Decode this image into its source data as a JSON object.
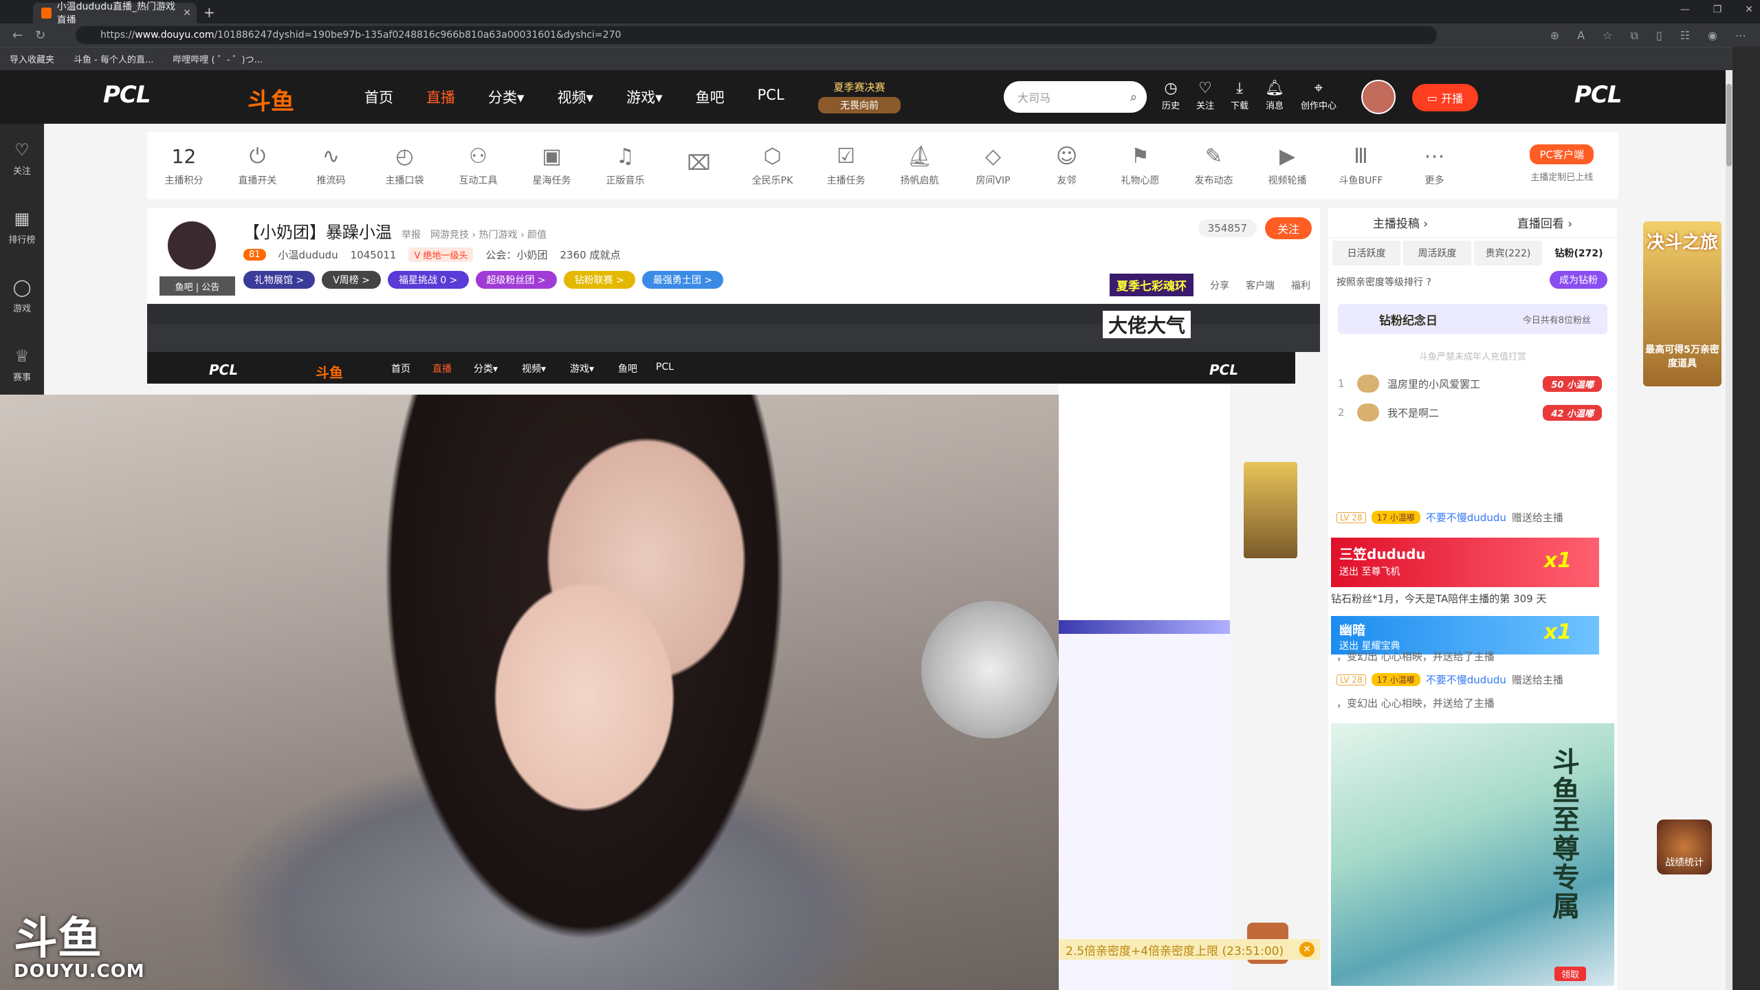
{
  "browser": {
    "tab_title": "小温dududu直播_热门游戏直播",
    "url_prefix": "https://",
    "url_host": "www.douyu.com",
    "url_path": "/101886247dyshid=190be97b-135af0248816c966b810a63a00031601&dyshci=270",
    "bookmarks": [
      "导入收藏夹",
      "斗鱼 - 每个人的直...",
      "哔哩哔哩 ( ゜- ゜)つ..."
    ]
  },
  "topnav": {
    "logo_left": "PCL",
    "logo_right": "PCL",
    "brand": "斗鱼",
    "items": [
      "首页",
      "直播",
      "分类▾",
      "视频▾",
      "游戏▾",
      "鱼吧",
      "PCL"
    ],
    "summer_line1": "夏季赛决赛",
    "summer_line2": "无畏向前",
    "search_placeholder": "大司马",
    "tools": [
      "历史",
      "关注",
      "下载",
      "消息",
      "创作中心"
    ],
    "kaibo": "开播"
  },
  "leftbar": [
    "关注",
    "排行榜",
    "游戏",
    "赛事"
  ],
  "toolbar": {
    "score_num": "12",
    "items": [
      "主播积分",
      "直播开关",
      "推流码",
      "主播口袋",
      "互动工具",
      "星海任务",
      "正版音乐",
      "",
      "全民乐PK",
      "主播任务",
      "扬帆启航",
      "房间VIP",
      "友邻",
      "礼物心愿",
      "发布动态",
      "视频轮播",
      "斗鱼BUFF",
      "更多"
    ],
    "pc_client": "PC客户端",
    "pc_status": "主播定制已上线"
  },
  "room": {
    "title": "【小奶团】暴躁小温",
    "report": "举报",
    "category": "网游竞技 › 热门游戏 › 颜值",
    "level": "81",
    "anchor": "小温dududu",
    "heat": "1045011",
    "vip": "V 绝地一级头",
    "guild": "公会：小奶团",
    "achieve": "2360 成就点",
    "fish_tag": "鱼吧 | 公告",
    "badges": [
      "礼物展馆 >",
      "V周榜 >",
      "福星挑战 0 >",
      "超级粉丝团 >",
      "钻粉联赛 >",
      "最强勇士团 >"
    ],
    "count": "354857",
    "follow": "关注",
    "seven": "夏季七彩魂环",
    "share": "分享",
    "client": "客户端",
    "welfare": "福利"
  },
  "panel": {
    "tab1": "主播投稿 ›",
    "tab2": "直播回看 ›",
    "subs": [
      "日活跃度",
      "周活跃度",
      "贵宾(222)",
      "钻粉(272)"
    ],
    "rank_hint": "按照亲密度等级排行 ?",
    "become": "成为钻粉",
    "zfan_title": "钻粉纪念日",
    "zfan_today": "今日共有8位粉丝",
    "minor": "斗鱼严禁未成年人充值打赏",
    "ranks": [
      {
        "n": "1",
        "name": "温房里的小风爱罢工",
        "badge": "50 小温嘟"
      },
      {
        "n": "2",
        "name": "我不是啊二",
        "badge": "42 小温嘟"
      }
    ],
    "chat1_lv": "LV 28",
    "chat1_fan": "17 小温嘟",
    "chat1_nick": "不要不慢dududu",
    "chat1_text": "赠送给主播",
    "gift1_name": "三笠dududu",
    "gift1_text": "送出  至尊飞机",
    "gift1_x": "x1",
    "anni_text": "钻石粉丝*1月，今天是TA陪伴主播的第 309 天",
    "gift2_name": "幽暗",
    "gift2_text": "送出  星耀宝典",
    "gift2_x": "x1",
    "chat2_text": "，变幻出 心心相映，并送给了主播",
    "chat3_lv": "LV 28",
    "chat3_fan": "17 小温嘟",
    "chat3_nick": "不要不慢dududu",
    "chat3_text": "赠送给主播",
    "chat4_text": "，变幻出 心心相映，并送给了主播",
    "promo_title": "斗鱼至尊专属",
    "promo_claim": "领取"
  },
  "far": {
    "title": "决斗之旅",
    "text": "最高可得5万亲密度道具",
    "zhanji": "战绩统计"
  },
  "stream": {
    "overlay": "大佬大气",
    "watermark1": "斗鱼",
    "watermark2": "DOUYU.COM",
    "bottom_bar": "2.5倍亲密度+4倍亲密度上限 (23:51:00)"
  }
}
